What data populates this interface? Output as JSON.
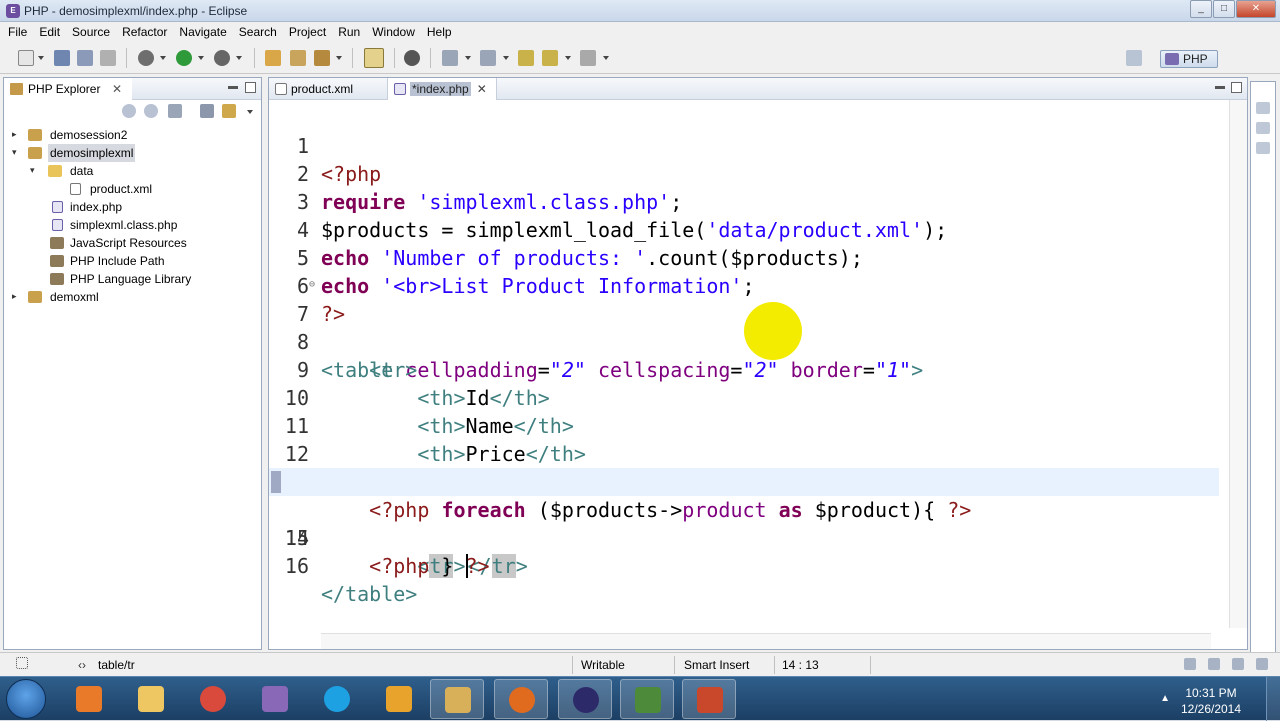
{
  "window": {
    "title": "PHP - demosimplexml/index.php - Eclipse",
    "minimize": "_",
    "maximize": "□",
    "close": "✕"
  },
  "menu": [
    "File",
    "Edit",
    "Source",
    "Refactor",
    "Navigate",
    "Search",
    "Project",
    "Run",
    "Window",
    "Help"
  ],
  "perspective": {
    "label": "PHP"
  },
  "explorer": {
    "tab_label": "PHP Explorer",
    "tab_close": "✕",
    "tree": [
      {
        "label": "demosession2",
        "icon": "project-icon"
      },
      {
        "label": "demosimplexml",
        "icon": "project-icon",
        "selected": true
      },
      {
        "label": "data",
        "icon": "folder-icon"
      },
      {
        "label": "product.xml",
        "icon": "xml-file-icon"
      },
      {
        "label": "index.php",
        "icon": "php-file-icon"
      },
      {
        "label": "simplexml.class.php",
        "icon": "php-file-icon"
      },
      {
        "label": "JavaScript Resources",
        "icon": "library-icon"
      },
      {
        "label": "PHP Include Path",
        "icon": "library-icon"
      },
      {
        "label": "PHP Language Library",
        "icon": "library-icon"
      },
      {
        "label": "demoxml",
        "icon": "project-icon"
      }
    ]
  },
  "editor": {
    "tabs": [
      {
        "label": "product.xml",
        "active": false
      },
      {
        "label": "*index.php",
        "active": true,
        "close": "✕"
      }
    ],
    "current_line": 14,
    "lines": [
      "<?php",
      "require 'simplexml.class.php';",
      "$products = simplexml_load_file('data/product.xml');",
      "echo 'Number of products: '.count($products);",
      "echo '<br>List Product Information';",
      "?>",
      "<table cellpadding=\"2\" cellspacing=\"2\" border=\"1\">",
      "    <tr>",
      "        <th>Id</th>",
      "        <th>Name</th>",
      "        <th>Price</th>",
      "    </tr>",
      "    <?php foreach ($products->product as $product){ ?>",
      "        <tr></tr>",
      "    <?php } ?>",
      "</table>"
    ]
  },
  "status": {
    "breadcrumb": "table/tr",
    "writable": "Writable",
    "insert_mode": "Smart Insert",
    "position": "14 : 13"
  },
  "taskbar": {
    "time": "10:31 PM",
    "date": "12/26/2014",
    "apps": [
      "media-player-icon",
      "file-manager-icon",
      "chrome-icon",
      "tools-icon",
      "skype-icon",
      "outlook-icon",
      "explorer-folder-icon",
      "firefox-icon",
      "eclipse-icon",
      "notepad-icon",
      "powerpoint-icon"
    ]
  },
  "colors": {
    "keyword": "#7f0055",
    "php_delim": "#8b1a1a",
    "string": "#2a00ff",
    "tag": "#3f7f7f",
    "attribute": "#7f007f",
    "current_line": "#e8f2fe",
    "marker": "#f3eb00"
  }
}
